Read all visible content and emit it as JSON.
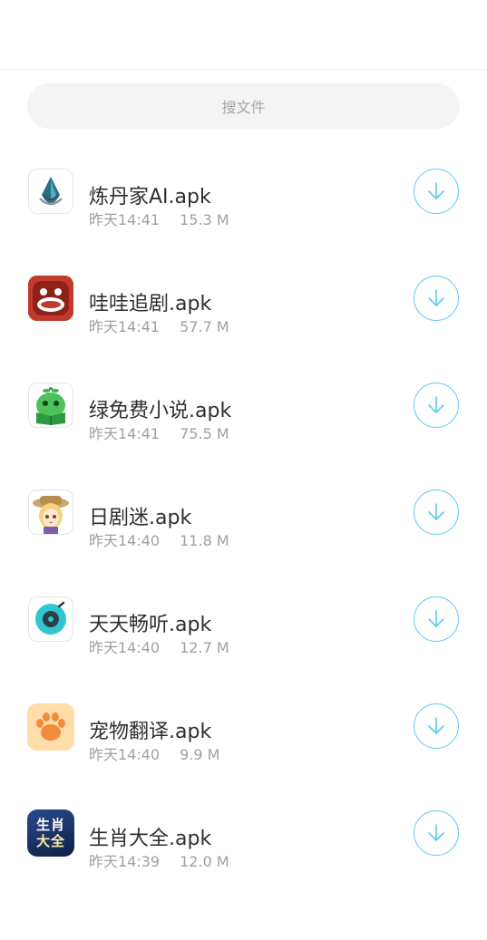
{
  "search": {
    "placeholder": "搜文件"
  },
  "files": [
    {
      "name": "炼丹家AI.apk",
      "time": "昨天14:41",
      "size": "15.3 M",
      "icon": "alchemist-ai-app-icon"
    },
    {
      "name": "哇哇追剧.apk",
      "time": "昨天14:41",
      "size": "57.7 M",
      "icon": "wawa-drama-app-icon"
    },
    {
      "name": "绿免费小说.apk",
      "time": "昨天14:41",
      "size": "75.5 M",
      "icon": "green-novel-app-icon"
    },
    {
      "name": "日剧迷.apk",
      "time": "昨天14:40",
      "size": "11.8 M",
      "icon": "jdrama-fan-app-icon"
    },
    {
      "name": "天天畅听.apk",
      "time": "昨天14:40",
      "size": "12.7 M",
      "icon": "daily-listen-app-icon"
    },
    {
      "name": "宠物翻译.apk",
      "time": "昨天14:40",
      "size": "9.9 M",
      "icon": "pet-translate-app-icon"
    },
    {
      "name": "生肖大全.apk",
      "time": "昨天14:39",
      "size": "12.0 M",
      "icon": "zodiac-app-icon",
      "icon_text": [
        "生肖",
        "大全"
      ]
    }
  ],
  "colors": {
    "accent": "#5fc9ec",
    "search_bg": "#f4f4f4",
    "meta_text": "#a0a0a0"
  }
}
